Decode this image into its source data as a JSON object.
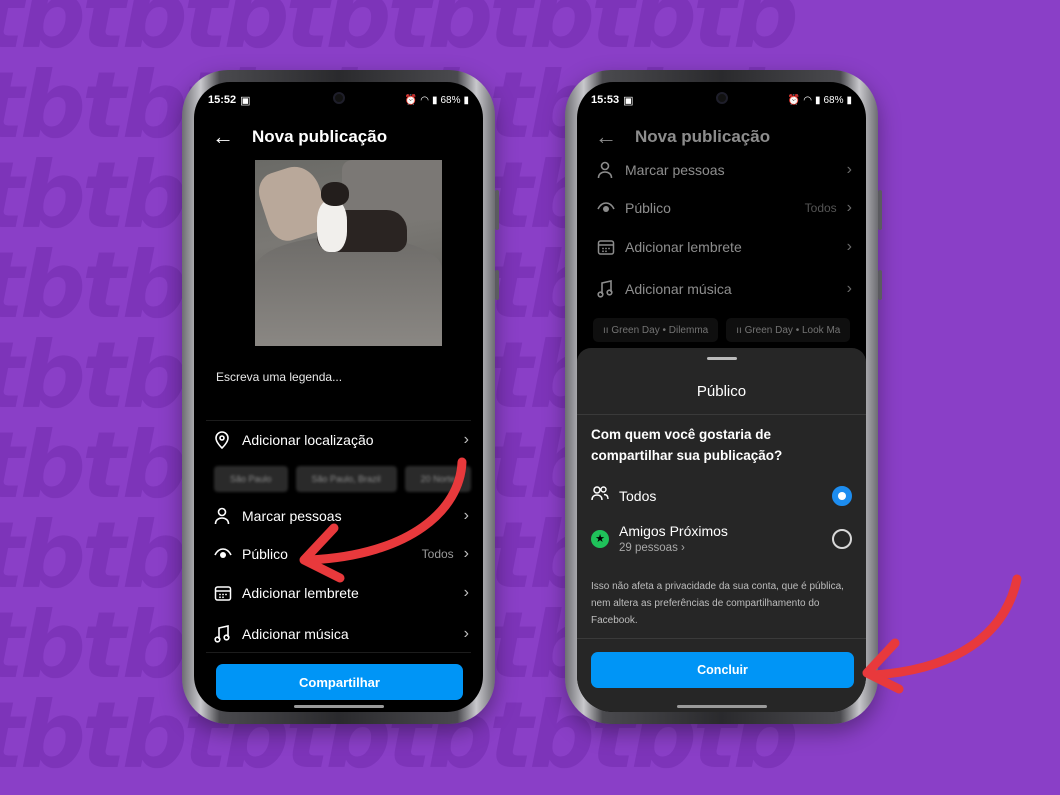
{
  "background": {
    "color": "#8a3fc7",
    "pattern_text": "tbtbtbtbtbtbtbtb"
  },
  "phone_left": {
    "status": {
      "time": "15:52",
      "battery": "68%"
    },
    "header": {
      "title": "Nova publicação"
    },
    "caption_placeholder": "Escreva uma legenda...",
    "rows": {
      "location": "Adicionar localização",
      "tag_people": "Marcar pessoas",
      "audience": "Público",
      "audience_value": "Todos",
      "reminder": "Adicionar lembrete",
      "music": "Adicionar música"
    },
    "location_chips": [
      "São Paulo",
      "São Paulo, Brazil",
      "20 Norte"
    ],
    "share_button": "Compartilhar"
  },
  "phone_right": {
    "status": {
      "time": "15:53",
      "battery": "68%"
    },
    "header": {
      "title": "Nova publicação"
    },
    "rows": {
      "tag_people": "Marcar pessoas",
      "audience": "Público",
      "audience_value": "Todos",
      "reminder": "Adicionar lembrete",
      "music": "Adicionar música"
    },
    "music_chips": [
      "Green Day • Dilemma",
      "Green Day • Look Ma"
    ],
    "sheet": {
      "title": "Público",
      "question": "Com quem você gostaria de compartilhar sua publicação?",
      "option_everyone": "Todos",
      "option_close_friends": "Amigos Próximos",
      "close_friends_count": "29 pessoas",
      "selected": "Todos",
      "disclaimer": "Isso não afeta a privacidade da sua conta, que é pública, nem altera as preferências de compartilhamento do Facebook.",
      "done_button": "Concluir"
    }
  },
  "colors": {
    "accent_blue": "#0095f6",
    "annotation_red": "#e8393c",
    "close_friends_green": "#1fc25a"
  },
  "icons": [
    "back-arrow-icon",
    "location-pin-icon",
    "person-icon",
    "eye-icon",
    "calendar-icon",
    "music-note-icon",
    "chevron-right-icon",
    "people-icon",
    "star-icon",
    "radio-selected-icon",
    "radio-unselected-icon",
    "red-arrow-annotation"
  ]
}
